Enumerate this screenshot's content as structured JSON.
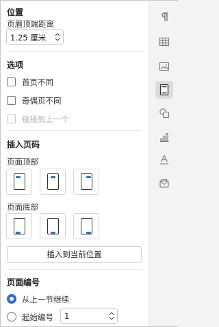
{
  "position": {
    "title": "位置",
    "header_distance_label": "页眉顶端距离",
    "header_distance_value": "1.25 厘米"
  },
  "options": {
    "title": "选项",
    "first_page_different": "首页不同",
    "odd_even_different": "奇偶页不同",
    "link_to_previous": "链接到上一个"
  },
  "insert": {
    "title": "插入页码",
    "top_label": "页面顶部",
    "bottom_label": "页面底部",
    "insert_button": "插入到当前位置"
  },
  "numbering": {
    "title": "页面编号",
    "continue_label": "从上一节继续",
    "start_label": "起始编号",
    "start_value": "1"
  },
  "rail": {
    "icons": [
      "paragraph-icon",
      "table-icon",
      "image-icon",
      "header-footer-icon",
      "shape-icon",
      "chart-icon",
      "text-effect-icon",
      "envelope-icon"
    ],
    "active": "header-footer-icon"
  },
  "colors": {
    "accent": "#2a6fd6"
  }
}
